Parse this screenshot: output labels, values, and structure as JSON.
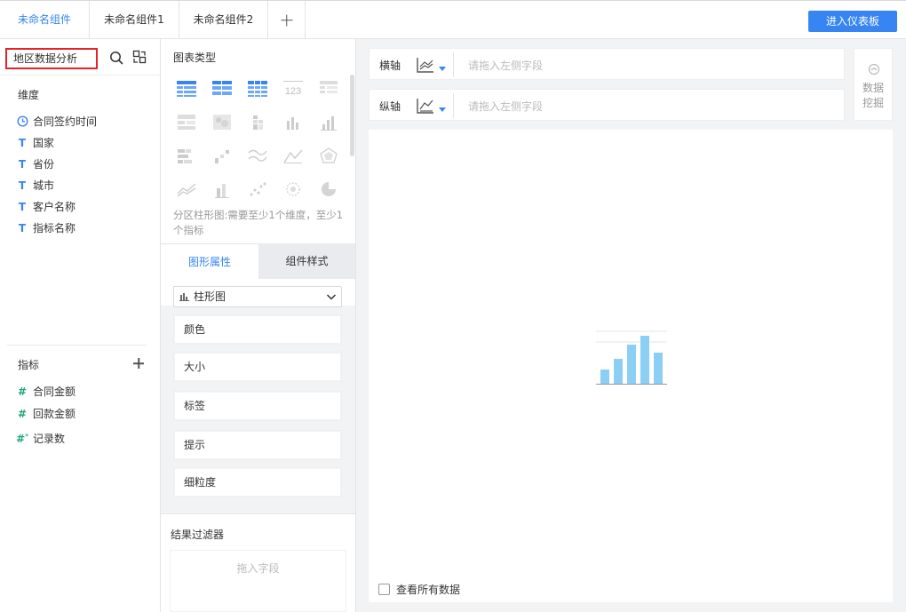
{
  "tabs": [
    {
      "label": "未命名组件",
      "active": true
    },
    {
      "label": "未命名组件1",
      "active": false
    },
    {
      "label": "未命名组件2",
      "active": false
    }
  ],
  "header": {
    "dashboard_button": "进入仪表板"
  },
  "left": {
    "dataset_name": "地区数据分析",
    "dimension_title": "维度",
    "dimensions": [
      {
        "label": "合同签约时间",
        "icon": "clock-icon"
      },
      {
        "label": "国家",
        "icon": "text-field-icon"
      },
      {
        "label": "省份",
        "icon": "text-field-icon"
      },
      {
        "label": "城市",
        "icon": "text-field-icon"
      },
      {
        "label": "客户名称",
        "icon": "text-field-icon"
      },
      {
        "label": "指标名称",
        "icon": "text-field-icon"
      }
    ],
    "metric_title": "指标",
    "metrics": [
      {
        "label": "合同金额",
        "icon": "number-field-icon"
      },
      {
        "label": "回款金额",
        "icon": "number-field-icon"
      },
      {
        "label": "记录数",
        "icon": "record-count-icon"
      }
    ]
  },
  "middle": {
    "chart_type_title": "图表类型",
    "chart_hint": "分区柱形图:需要至少1个维度，至少1个指标",
    "tabs": [
      "图形属性",
      "组件样式"
    ],
    "chart_select": "柱形图",
    "properties": [
      "颜色",
      "大小",
      "标签",
      "提示",
      "细粒度"
    ],
    "filter_title": "结果过滤器",
    "filter_placeholder": "拖入字段"
  },
  "axes": {
    "x_label": "横轴",
    "y_label": "纵轴",
    "placeholder": "请拖入左侧字段"
  },
  "mining": {
    "label_line1": "数据",
    "label_line2": "挖掘"
  },
  "canvas": {
    "view_all": "查看所有数据"
  },
  "colors": {
    "accent": "#3685f2",
    "highlight_border": "#e8202a",
    "field_metric": "#1fa67a",
    "placeholder_bar": "#8ccff5"
  }
}
